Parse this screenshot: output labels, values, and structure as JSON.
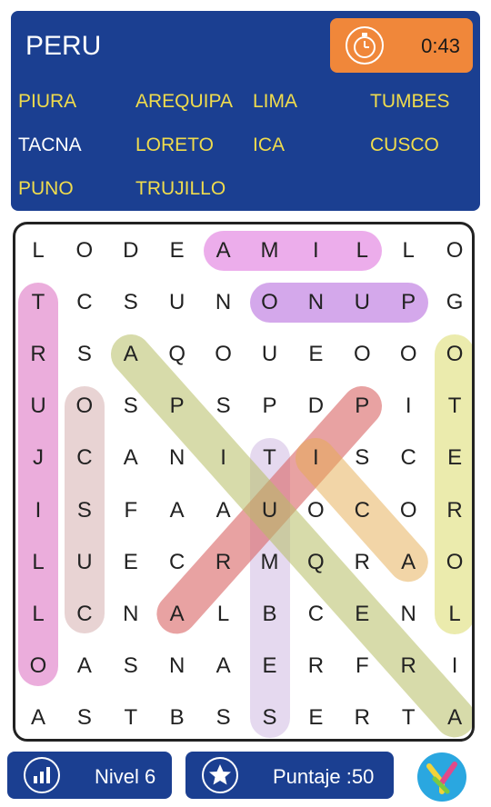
{
  "header": {
    "title": "PERU",
    "timer": "0:43",
    "words": [
      {
        "label": "PIURA",
        "found": false
      },
      {
        "label": "AREQUIPA",
        "found": false
      },
      {
        "label": "LIMA",
        "found": false
      },
      {
        "label": "TUMBES",
        "found": false
      },
      {
        "label": "TACNA",
        "found": true
      },
      {
        "label": "LORETO",
        "found": false
      },
      {
        "label": "ICA",
        "found": false
      },
      {
        "label": "CUSCO",
        "found": false
      },
      {
        "label": "PUNO",
        "found": false
      },
      {
        "label": "TRUJILLO",
        "found": false
      }
    ]
  },
  "grid": {
    "rows": [
      [
        "L",
        "O",
        "D",
        "E",
        "A",
        "M",
        "I",
        "L",
        "L",
        "O"
      ],
      [
        "T",
        "C",
        "S",
        "U",
        "N",
        "O",
        "N",
        "U",
        "P",
        "G"
      ],
      [
        "R",
        "S",
        "A",
        "Q",
        "O",
        "U",
        "E",
        "O",
        "O",
        "O"
      ],
      [
        "U",
        "O",
        "S",
        "P",
        "S",
        "P",
        "D",
        "P",
        "I",
        "T"
      ],
      [
        "J",
        "C",
        "A",
        "N",
        "I",
        "T",
        "I",
        "S",
        "C",
        "E"
      ],
      [
        "I",
        "S",
        "F",
        "A",
        "A",
        "U",
        "O",
        "C",
        "O",
        "R"
      ],
      [
        "L",
        "U",
        "E",
        "C",
        "R",
        "M",
        "Q",
        "R",
        "A",
        "O"
      ],
      [
        "L",
        "C",
        "N",
        "A",
        "L",
        "B",
        "C",
        "E",
        "N",
        "L"
      ],
      [
        "O",
        "A",
        "S",
        "N",
        "A",
        "E",
        "R",
        "F",
        "R",
        "I"
      ],
      [
        "A",
        "S",
        "T",
        "B",
        "S",
        "S",
        "E",
        "R",
        "T",
        "A"
      ]
    ],
    "highlights": [
      {
        "from": [
          0,
          4
        ],
        "to": [
          0,
          7
        ],
        "color": "rgba(224,118,222,0.6)"
      },
      {
        "from": [
          1,
          5
        ],
        "to": [
          1,
          8
        ],
        "color": "rgba(176,96,218,0.55)"
      },
      {
        "from": [
          1,
          0
        ],
        "to": [
          8,
          0
        ],
        "color": "rgba(222,118,196,0.6)"
      },
      {
        "from": [
          3,
          1
        ],
        "to": [
          7,
          1
        ],
        "color": "rgba(205,158,158,0.45)"
      },
      {
        "from": [
          2,
          9
        ],
        "to": [
          7,
          9
        ],
        "color": "rgba(222,222,118,0.6)"
      },
      {
        "from": [
          4,
          5
        ],
        "to": [
          9,
          5
        ],
        "color": "rgba(198,170,220,0.45)"
      },
      {
        "from": [
          3,
          7
        ],
        "to": [
          7,
          3
        ],
        "color": "rgba(216,100,100,0.6)"
      },
      {
        "from": [
          4,
          6
        ],
        "to": [
          6,
          8
        ],
        "color": "rgba(230,172,80,0.5)"
      },
      {
        "from": [
          2,
          2
        ],
        "to": [
          9,
          9
        ],
        "color": "rgba(182,190,100,0.55)"
      }
    ]
  },
  "footer": {
    "level_label": "Nivel 6",
    "score_label": "Puntaje :50"
  }
}
